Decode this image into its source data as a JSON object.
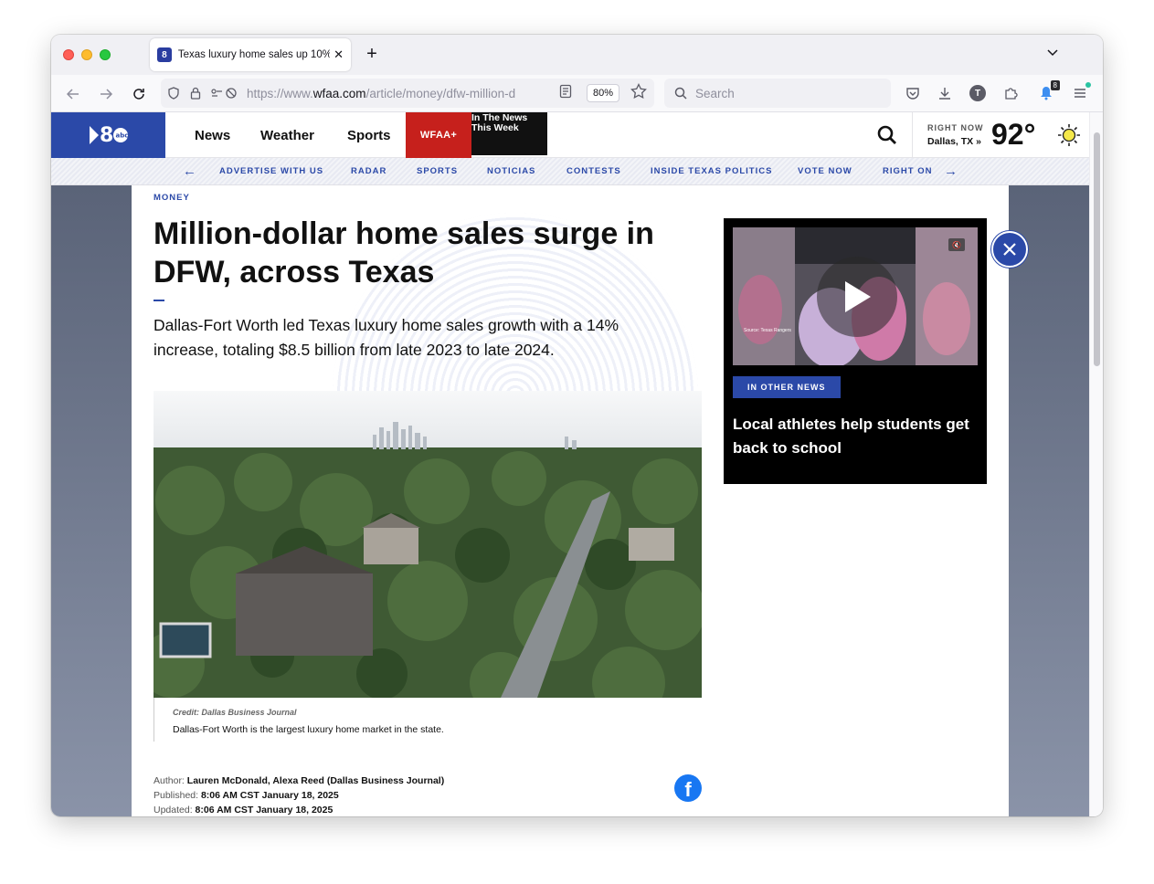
{
  "browser": {
    "tab_title": "Texas luxury home sales up 10%",
    "url_prefix": "https://www.",
    "url_domain": "wfaa.com",
    "url_path": "/article/money/dfw-million-d",
    "zoom": "80%",
    "search_placeholder": "Search",
    "notification_count": "8",
    "avatar_letter": "T"
  },
  "site": {
    "nav": [
      "News",
      "Weather",
      "Sports"
    ],
    "wfaa_plus": "WFAA+",
    "itnw_line1": "In The News",
    "itnw_line2": "This Week",
    "weather_label": "RIGHT NOW",
    "weather_city": "Dallas, TX »",
    "weather_temp": "92°"
  },
  "subnav": [
    "ADVERTISE WITH US",
    "RADAR",
    "SPORTS",
    "NOTICIAS",
    "CONTESTS",
    "INSIDE TEXAS POLITICS",
    "VOTE NOW",
    "RIGHT ON"
  ],
  "article": {
    "category": "MONEY",
    "headline": "Million-dollar home sales surge in DFW, across Texas",
    "summary": "Dallas-Fort Worth led Texas luxury home sales growth with a 14% increase, totaling $8.5 billion from late 2023 to late 2024.",
    "credit": "Credit: Dallas Business Journal",
    "caption": "Dallas-Fort Worth is the largest luxury home market in the state.",
    "author_label": "Author:",
    "author": "Lauren McDonald, Alexa Reed (Dallas Business Journal)",
    "published_label": "Published:",
    "published": "8:06 AM CST January 18, 2025",
    "updated_label": "Updated:",
    "updated": "8:06 AM CST January 18, 2025"
  },
  "video": {
    "badge": "IN OTHER NEWS",
    "title": "Local athletes help students get back to school",
    "source": "Source: Texas Rangers"
  },
  "colors": {
    "brand": "#2b49a8",
    "wfaa_plus": "#c6201c"
  }
}
